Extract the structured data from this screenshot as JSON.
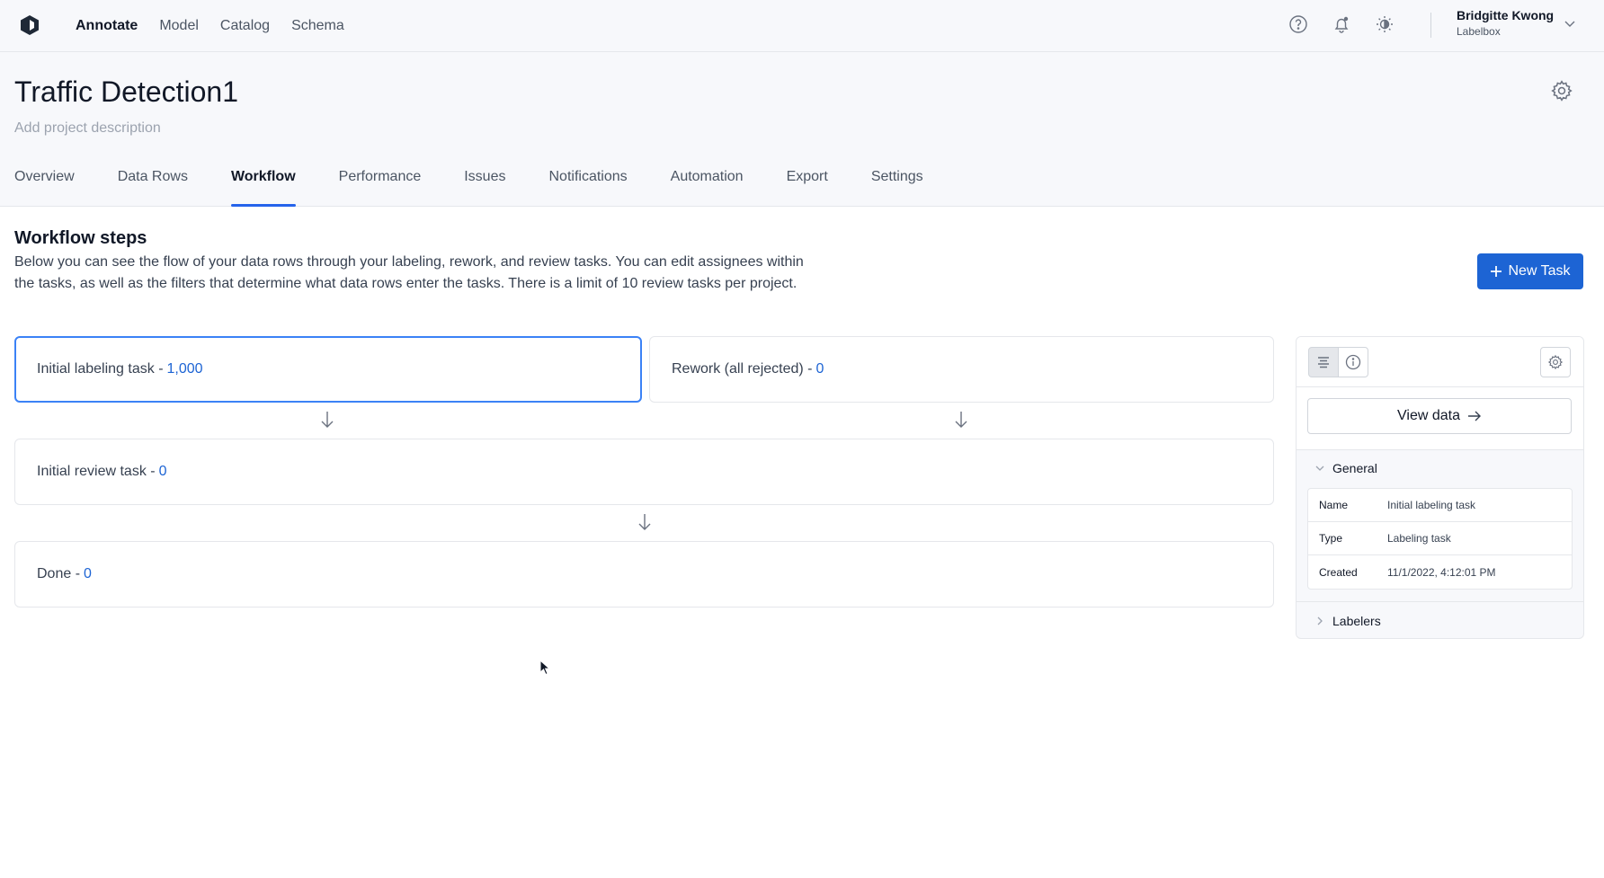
{
  "nav": {
    "links": [
      "Annotate",
      "Model",
      "Catalog",
      "Schema"
    ],
    "active": "Annotate",
    "icons": [
      "help-icon",
      "bell-icon",
      "theme-icon"
    ],
    "user": {
      "name": "Bridgitte Kwong",
      "org": "Labelbox"
    }
  },
  "project": {
    "title": "Traffic Detection1",
    "description_placeholder": "Add project description",
    "tabs": [
      "Overview",
      "Data Rows",
      "Workflow",
      "Performance",
      "Issues",
      "Notifications",
      "Automation",
      "Export",
      "Settings"
    ],
    "active_tab": "Workflow"
  },
  "workflow": {
    "title": "Workflow steps",
    "description": "Below you can see the flow of your data rows through your labeling, rework, and review tasks. You can edit assignees within the tasks, as well as the filters that determine what data rows enter the tasks. There is a limit of 10 review tasks per project.",
    "new_task_label": "New Task",
    "cards": {
      "initial_labeling": {
        "label": "Initial labeling task - ",
        "count": "1,000"
      },
      "rework": {
        "label": "Rework (all rejected) - ",
        "count": "0"
      },
      "initial_review": {
        "label": "Initial review task - ",
        "count": "0"
      },
      "done": {
        "label": "Done - ",
        "count": "0"
      }
    }
  },
  "panel": {
    "view_data_label": "View data",
    "general_label": "General",
    "info": [
      {
        "key": "Name",
        "value": "Initial labeling task"
      },
      {
        "key": "Type",
        "value": "Labeling task"
      },
      {
        "key": "Created",
        "value": "11/1/2022, 4:12:01 PM"
      }
    ],
    "labelers_label": "Labelers"
  },
  "colors": {
    "accent": "#1d64d4",
    "selected_border": "#3b82f6"
  }
}
